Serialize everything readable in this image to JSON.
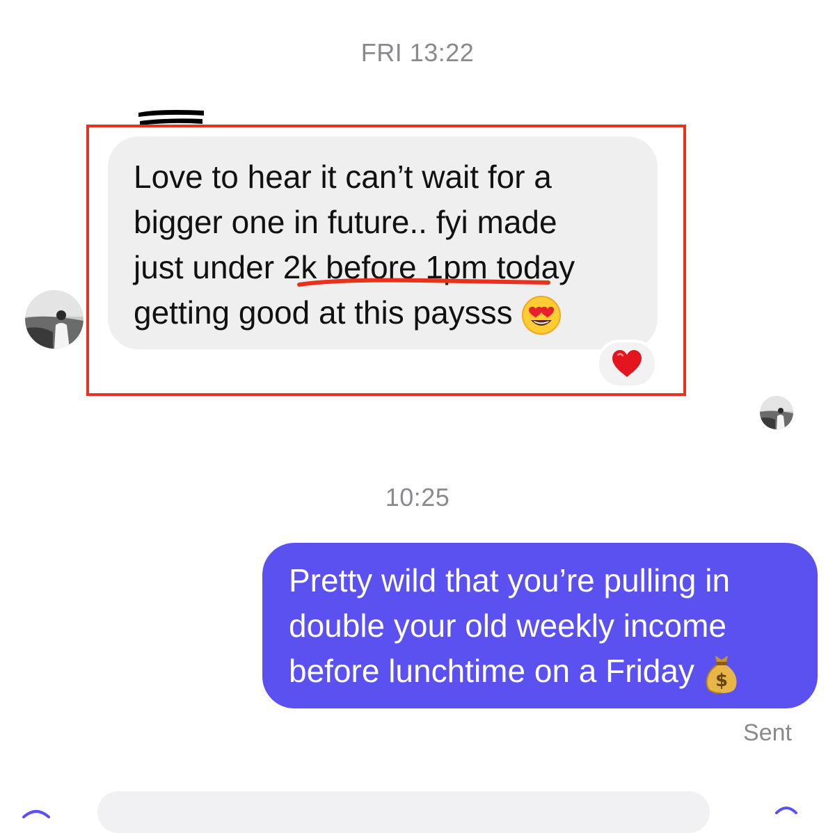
{
  "thread": {
    "timestamps": [
      "FRI 13:22",
      "10:25"
    ],
    "incoming": {
      "sender_name_redacted": true,
      "lines": [
        "Love to hear it can’t wait for a",
        "bigger one in future.. fyi made",
        "just under 2k before 1pm today",
        "getting good at this paysss"
      ],
      "trailing_emoji": "smiling-face-with-heart-eyes-icon",
      "reaction": "red-heart-icon",
      "highlighted_phrase": "2k before 1pm"
    },
    "outgoing": {
      "lines": [
        "Pretty wild that you’re pulling in",
        "double your old weekly income",
        "before lunchtime on a Friday"
      ],
      "trailing_emoji": "money-bag-icon",
      "status": "Sent"
    }
  },
  "colors": {
    "outgoing_bubble": "#5b51f0",
    "incoming_bubble": "#efefef",
    "annotation_red": "#e8321e",
    "timestamp_gray": "#8a8a8e"
  }
}
